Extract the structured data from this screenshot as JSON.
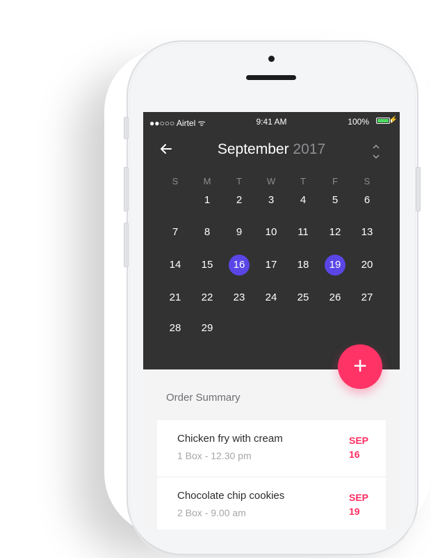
{
  "status_bar": {
    "carrier": "●●○○○ Airtel ᯤ",
    "time": "9:41 AM",
    "battery": "100%",
    "battery_level": 1.0,
    "charging_icon": "bolt-icon"
  },
  "calendar": {
    "back_icon": "arrow-left-icon",
    "month": "September",
    "year": "2017",
    "toggle_icon": "chevron-up-down-icon",
    "weekdays": [
      "S",
      "M",
      "T",
      "W",
      "T",
      "F",
      "S"
    ],
    "weeks": [
      [
        "",
        "1",
        "2",
        "3",
        "4",
        "5",
        "6"
      ],
      [
        "7",
        "8",
        "9",
        "10",
        "11",
        "12",
        "13"
      ],
      [
        "14",
        "15",
        "16",
        "17",
        "18",
        "19",
        "20"
      ],
      [
        "21",
        "22",
        "23",
        "24",
        "25",
        "26",
        "27"
      ],
      [
        "28",
        "29",
        "",
        "",
        "",
        "",
        ""
      ]
    ],
    "selected_dates": [
      "16",
      "19"
    ],
    "selected_color": "#5a46e6"
  },
  "fab": {
    "label": "+",
    "color": "#ff3366"
  },
  "order_summary": {
    "title": "Order Summary",
    "orders": [
      {
        "name": "Chicken fry with cream",
        "detail": "1 Box - 12.30 pm",
        "month": "SEP",
        "day": "16"
      },
      {
        "name": "Chocolate chip cookies",
        "detail": "2 Box - 9.00 am",
        "month": "SEP",
        "day": "19"
      }
    ],
    "accent_color": "#ff2e63"
  }
}
